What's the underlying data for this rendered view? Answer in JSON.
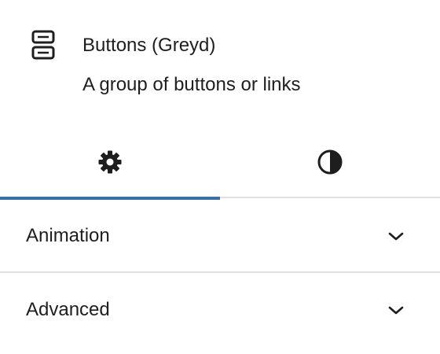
{
  "block": {
    "icon": "buttons-block-icon",
    "title": "Buttons (Greyd)",
    "description": "A group of buttons or links"
  },
  "tabs": [
    {
      "name": "settings",
      "icon": "gear-icon",
      "active": true
    },
    {
      "name": "styles",
      "icon": "half-circle-contrast-icon",
      "active": false
    }
  ],
  "panels": [
    {
      "label": "Animation",
      "icon": "chevron-down-icon",
      "expanded": false
    },
    {
      "label": "Advanced",
      "icon": "chevron-down-icon",
      "expanded": false
    }
  ],
  "colors": {
    "accent": "#3a6ea5",
    "text": "#1e1e1e",
    "divider": "#e0e0e0"
  }
}
